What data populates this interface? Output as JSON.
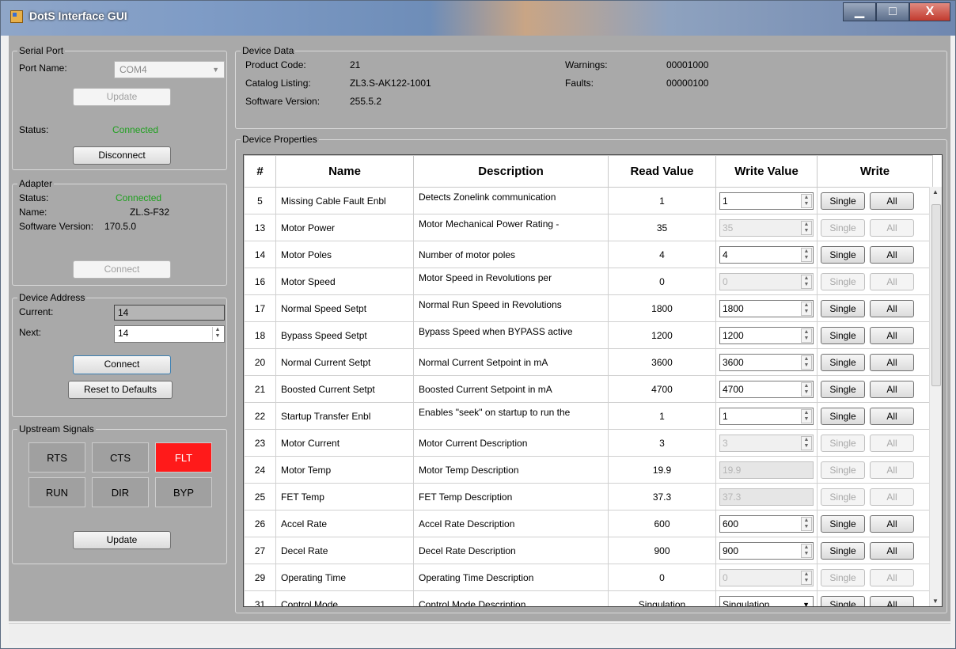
{
  "window": {
    "title": "DotS Interface GUI",
    "min": "▁",
    "max": "□",
    "close": "X"
  },
  "serial_port": {
    "legend": "Serial Port",
    "port_name_label": "Port Name:",
    "port_name_value": "COM4",
    "update_label": "Update",
    "status_label": "Status:",
    "status_value": "Connected",
    "disconnect_label": "Disconnect"
  },
  "adapter": {
    "legend": "Adapter",
    "status_label": "Status:",
    "status_value": "Connected",
    "name_label": "Name:",
    "name_value": "ZL.S-F32",
    "sw_label": "Software Version:",
    "sw_value": "170.5.0",
    "connect_label": "Connect"
  },
  "device_address": {
    "legend": "Device Address",
    "current_label": "Current:",
    "current_value": "14",
    "next_label": "Next:",
    "next_value": "14",
    "connect_label": "Connect",
    "reset_label": "Reset to Defaults"
  },
  "upstream": {
    "legend": "Upstream Signals",
    "signals": [
      "RTS",
      "CTS",
      "FLT",
      "RUN",
      "DIR",
      "BYP"
    ],
    "update_label": "Update",
    "fault_color": "#ff1a1a"
  },
  "device_data": {
    "legend": "Device Data",
    "product_code_label": "Product Code:",
    "product_code_value": "21",
    "catalog_label": "Catalog Listing:",
    "catalog_value": "ZL3.S-AK122-1001",
    "software_label": "Software Version:",
    "software_value": "255.5.2",
    "warnings_label": "Warnings:",
    "warnings_value": "00001000",
    "faults_label": "Faults:",
    "faults_value": "00000100"
  },
  "properties": {
    "legend": "Device Properties",
    "headers": [
      "#",
      "Name",
      "Description",
      "Read Value",
      "Write Value",
      "Write"
    ],
    "single_label": "Single",
    "all_label": "All",
    "rows": [
      {
        "id": "5",
        "name": "Missing Cable Fault Enbl",
        "desc": "Detects Zonelink communication",
        "read": "1",
        "write": "1",
        "mode": "spin",
        "top": true
      },
      {
        "id": "13",
        "name": "Motor Power",
        "desc": "Motor Mechanical Power Rating -",
        "read": "35",
        "write": "35",
        "mode": "spin-dis",
        "top": true
      },
      {
        "id": "14",
        "name": "Motor Poles",
        "desc": "Number of motor poles",
        "read": "4",
        "write": "4",
        "mode": "spin",
        "top": false
      },
      {
        "id": "16",
        "name": "Motor Speed",
        "desc": "Motor Speed in Revolutions per",
        "read": "0",
        "write": "0",
        "mode": "spin-dis",
        "top": true
      },
      {
        "id": "17",
        "name": "Normal Speed Setpt",
        "desc": "Normal Run Speed in Revolutions",
        "read": "1800",
        "write": "1800",
        "mode": "spin",
        "top": true
      },
      {
        "id": "18",
        "name": "Bypass Speed Setpt",
        "desc": "Bypass Speed when BYPASS active",
        "read": "1200",
        "write": "1200",
        "mode": "spin",
        "top": true
      },
      {
        "id": "20",
        "name": "Normal Current Setpt",
        "desc": "Normal Current Setpoint in mA",
        "read": "3600",
        "write": "3600",
        "mode": "spin",
        "top": false
      },
      {
        "id": "21",
        "name": "Boosted Current Setpt",
        "desc": "Boosted Current Setpoint in mA",
        "read": "4700",
        "write": "4700",
        "mode": "spin",
        "top": false
      },
      {
        "id": "22",
        "name": "Startup Transfer Enbl",
        "desc": "Enables \"seek\" on startup to run the",
        "read": "1",
        "write": "1",
        "mode": "spin",
        "top": true
      },
      {
        "id": "23",
        "name": "Motor Current",
        "desc": "Motor Current Description",
        "read": "3",
        "write": "3",
        "mode": "spin-dis",
        "top": false
      },
      {
        "id": "24",
        "name": "Motor Temp",
        "desc": "Motor Temp Description",
        "read": "19.9",
        "write": "19.9",
        "mode": "ro",
        "top": false
      },
      {
        "id": "25",
        "name": "FET Temp",
        "desc": "FET Temp Description",
        "read": "37.3",
        "write": "37.3",
        "mode": "ro",
        "top": false
      },
      {
        "id": "26",
        "name": "Accel Rate",
        "desc": "Accel Rate Description",
        "read": "600",
        "write": "600",
        "mode": "spin",
        "top": false
      },
      {
        "id": "27",
        "name": "Decel Rate",
        "desc": "Decel Rate Description",
        "read": "900",
        "write": "900",
        "mode": "spin",
        "top": false
      },
      {
        "id": "29",
        "name": "Operating Time",
        "desc": "Operating Time Description",
        "read": "0",
        "write": "0",
        "mode": "spin-dis",
        "top": false
      },
      {
        "id": "31",
        "name": "Control Mode",
        "desc": "Control Mode Description",
        "read": "Singulation",
        "write": "Singulation",
        "mode": "dropdown",
        "top": false
      }
    ]
  }
}
